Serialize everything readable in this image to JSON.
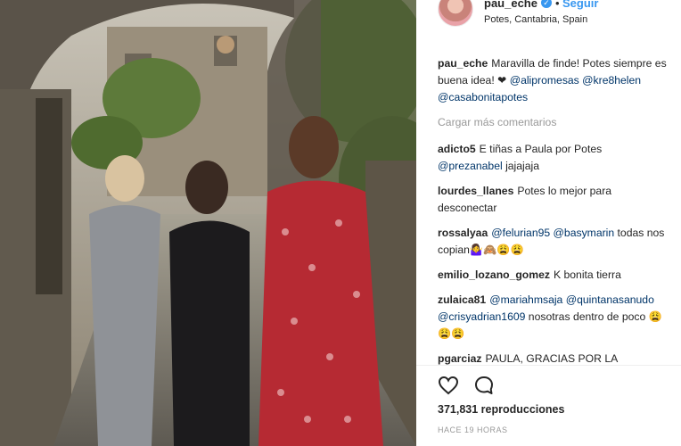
{
  "header": {
    "username": "pau_eche",
    "verified_icon": "verified-badge-icon",
    "separator": "•",
    "follow_label": "Seguir",
    "location": "Potes, Cantabria, Spain"
  },
  "caption": {
    "username": "pau_eche",
    "text": "Maravilla de finde! Potes siempre es buena idea! ❤ ",
    "mentions": [
      "@alipromesas",
      "@kre8helen",
      "@casabonitapotes"
    ]
  },
  "load_more": "Cargar más comentarios",
  "comments": [
    {
      "username": "adicto5",
      "text": "E tiñas a Paula por Potes",
      "mention": "@prezanabel",
      "tail": " jajajaja"
    },
    {
      "username": "lourdes_llanes",
      "text": "Potes lo mejor para desconectar"
    },
    {
      "username": "rossalyaa",
      "mention": "@felurian95",
      "mention2": "@basymarin",
      "tail": " todas nos copian🤷‍♀️🙈😩😩"
    },
    {
      "username": "emilio_lozano_gomez",
      "text": "K bonita tierra"
    },
    {
      "username": "zulaica81",
      "mention": "@mariahmsaja",
      "mention2": "@quintanasanudo",
      "mention3": "@crisyadrian1609",
      "tail": " nosotras dentro de poco 😩😩😩"
    },
    {
      "username": "pgarciaz",
      "text": "PAULA, GRACIAS POR LA UBICACIÓN. Todavía hay medios de comunicación que ponen que está en"
    }
  ],
  "actions": {
    "like_icon": "heart-icon",
    "comment_icon": "comment-bubble-icon"
  },
  "views": "371,831 reproducciones",
  "timestamp": "HACE 19 HORAS",
  "colors": {
    "link": "#003569",
    "accent": "#3897f0",
    "muted": "#999999"
  }
}
